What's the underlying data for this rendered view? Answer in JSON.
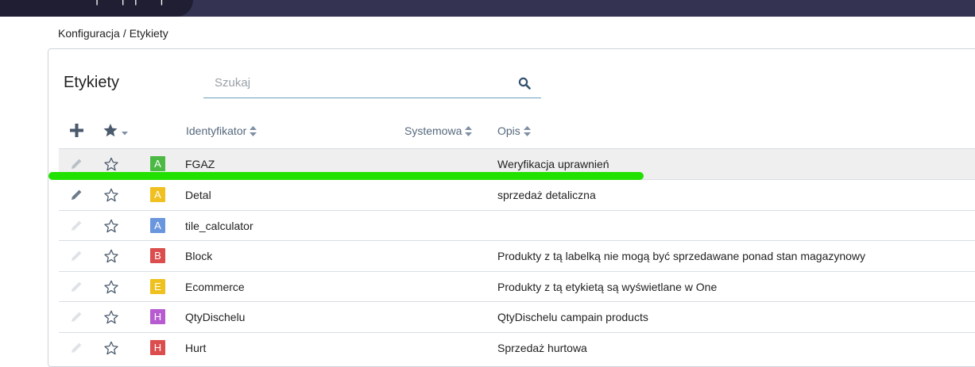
{
  "breadcrumb": {
    "section": "Konfiguracja",
    "separator": "/",
    "page": "Etykiety"
  },
  "page_title": "Etykiety",
  "search": {
    "placeholder": "Szukaj",
    "value": ""
  },
  "table": {
    "columns": {
      "identifier": "Identyfikator",
      "system": "Systemowa",
      "description": "Opis"
    },
    "rows": [
      {
        "badge": "A",
        "badge_color": "#4cb944",
        "identifier": "FGAZ",
        "description": "Weryfikacja uprawnień",
        "edit_enabled": false,
        "highlighted": true
      },
      {
        "badge": "A",
        "badge_color": "#f0c020",
        "identifier": "Detal",
        "description": "sprzedaż detaliczna",
        "edit_enabled": true
      },
      {
        "badge": "A",
        "badge_color": "#6a96de",
        "identifier": "tile_calculator",
        "description": "",
        "edit_enabled": false
      },
      {
        "badge": "B",
        "badge_color": "#dc4e4e",
        "identifier": "Block",
        "description": "Produkty z tą labelką nie mogą być sprzedawane ponad stan magazynowy",
        "edit_enabled": false
      },
      {
        "badge": "E",
        "badge_color": "#efc11f",
        "identifier": "Ecommerce",
        "description": "Produkty z tą etykietą są wyświetlane w One",
        "edit_enabled": false
      },
      {
        "badge": "H",
        "badge_color": "#b75bd0",
        "identifier": "QtyDischelu",
        "description": "QtyDischelu campain products",
        "edit_enabled": false
      },
      {
        "badge": "H",
        "badge_color": "#dc4e4e",
        "identifier": "Hurt",
        "description": "Sprzedaż hurtowa",
        "edit_enabled": false
      }
    ]
  },
  "colors": {
    "topbar": "#343352",
    "annotation": "#22e000",
    "header_text": "#55687d"
  }
}
